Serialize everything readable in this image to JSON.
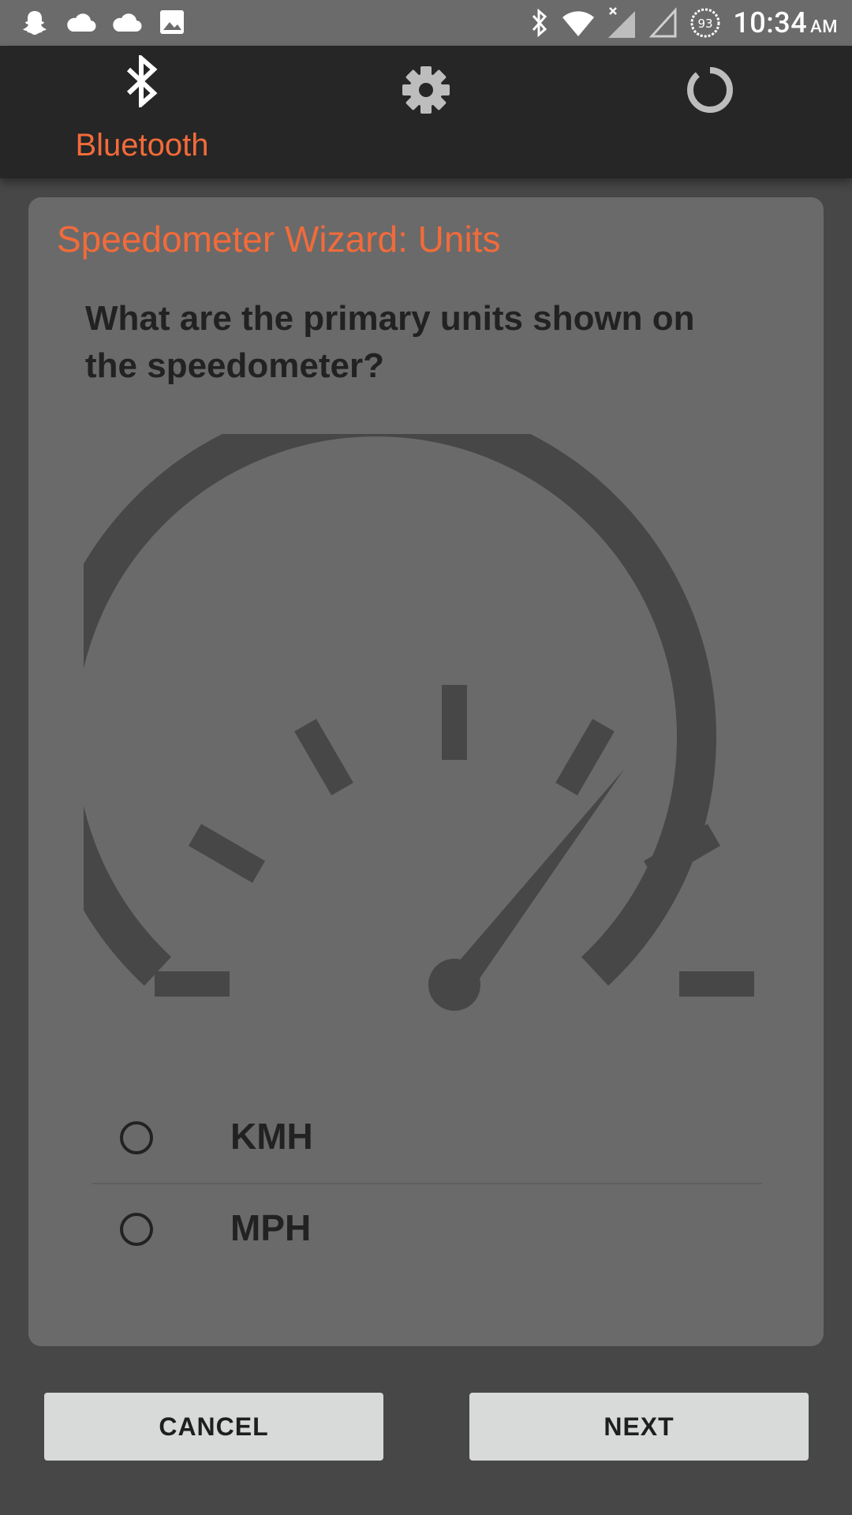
{
  "status_bar": {
    "time": "10:34",
    "ampm": "AM",
    "battery": "93",
    "icons": [
      "snapchat-icon",
      "cloud-icon",
      "cloud-icon",
      "image-icon",
      "bluetooth-icon",
      "wifi-icon",
      "signal-icon",
      "signal-empty-icon",
      "battery-icon"
    ]
  },
  "app_bar": {
    "tabs": [
      {
        "label": "Bluetooth",
        "icon": "bluetooth-icon",
        "active": true
      },
      {
        "label": "",
        "icon": "gear-icon"
      },
      {
        "label": "",
        "icon": "spinner-icon"
      }
    ],
    "accent": "#f26b3a"
  },
  "card": {
    "title": "Speedometer Wizard: Units",
    "question": "What are the primary units shown on the speedometer?",
    "options": [
      {
        "label": "KMH",
        "selected": false
      },
      {
        "label": "MPH",
        "selected": false
      }
    ]
  },
  "buttons": {
    "cancel": "CANCEL",
    "next": "NEXT"
  }
}
